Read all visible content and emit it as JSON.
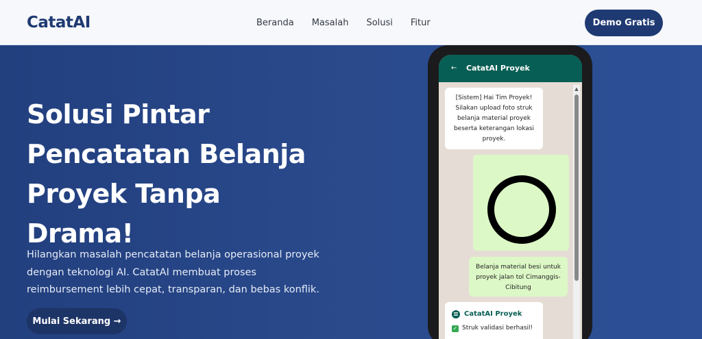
{
  "nav": {
    "logo": "CatatAI",
    "menu": [
      "Beranda",
      "Masalah",
      "Solusi",
      "Fitur"
    ],
    "demo_button": "Demo Gratis"
  },
  "hero": {
    "headline": "Solusi Pintar Pencatatan Belanja Proyek Tanpa Drama!",
    "subtext": "Hilangkan masalah pencatatan belanja operasional proyek dengan teknologi AI. CatatAI membuat proses reimbursement lebih cepat, transparan, dan bebas konflik.",
    "cta": "Mulai Sekarang →"
  },
  "chat": {
    "title": "CatatAI Proyek",
    "messages": {
      "system": "[Sistem] Hai Tim Proyek! Silakan upload foto struk belanja material proyek beserta keterangan lokasi proyek.",
      "user_caption": "Belanja material besi untuk proyek jalan tol Cimanggis-Cibitung",
      "bot_name": "CatatAI Proyek",
      "bot_check": "Struk validasi berhasil!"
    }
  }
}
